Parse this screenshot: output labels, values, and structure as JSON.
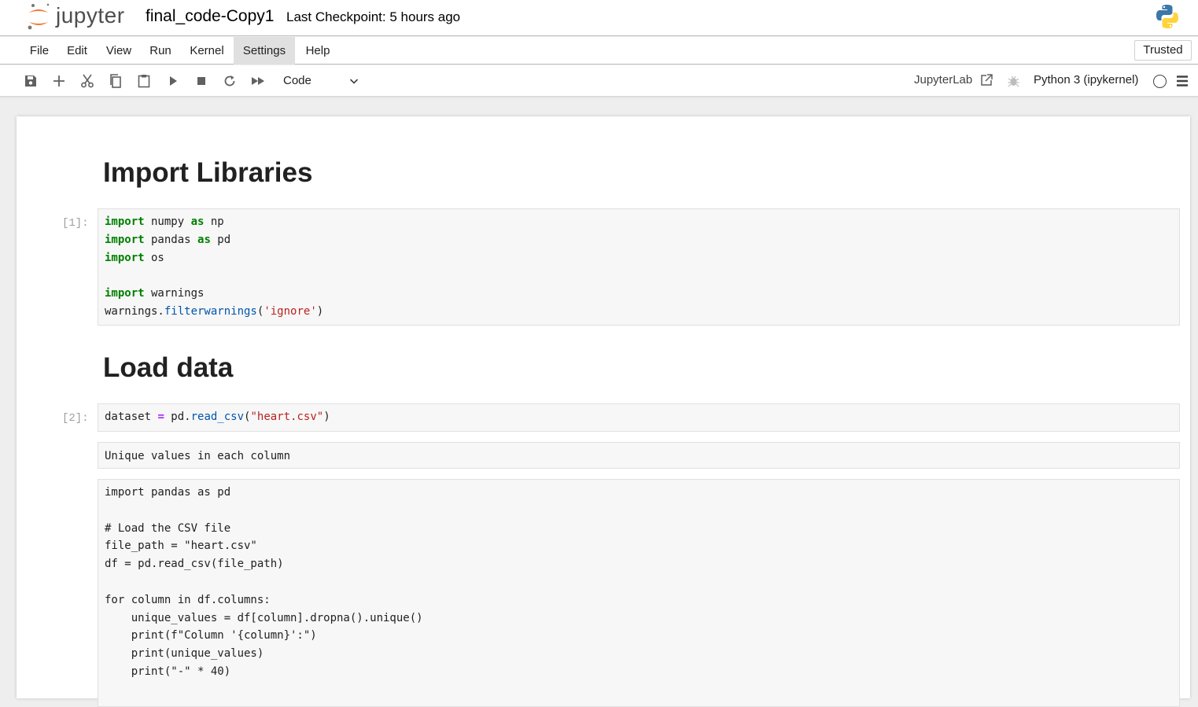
{
  "header": {
    "logo_text": "jupyter",
    "notebook_title": "final_code-Copy1",
    "checkpoint": "Last Checkpoint: 5 hours ago"
  },
  "menu": {
    "items": [
      "File",
      "Edit",
      "View",
      "Run",
      "Kernel",
      "Settings",
      "Help"
    ],
    "active": "Settings",
    "trusted": "Trusted"
  },
  "toolbar": {
    "buttons": [
      "save-icon",
      "add-cell-icon",
      "cut-icon",
      "copy-icon",
      "paste-icon",
      "run-icon",
      "stop-icon",
      "restart-icon",
      "fast-forward-icon"
    ],
    "cell_type": "Code",
    "jupyterlab_label": "JupyterLab",
    "kernel_name": "Python 3 (ipykernel)"
  },
  "cells": {
    "heading1": "Import Libraries",
    "prompt1": "[1]:",
    "heading2": "Load data",
    "prompt2": "[2]:",
    "code1_lines": [
      "import numpy as np",
      "import pandas as pd",
      "import os",
      "",
      "import warnings",
      "warnings.filterwarnings('ignore')"
    ],
    "code2_line": "dataset = pd.read_csv(\"heart.csv\")",
    "raw1": "Unique values in each column",
    "raw2_lines": [
      "import pandas as pd",
      "",
      "# Load the CSV file",
      "file_path = \"heart.csv\"",
      "df = pd.read_csv(file_path)",
      "",
      "for column in df.columns:",
      "    unique_values = df[column].dropna().unique()",
      "    print(f\"Column '{column}':\")",
      "    print(unique_values)",
      "    print(\"-\" * 40)"
    ]
  },
  "colors": {
    "keyword": "#008000",
    "operator": "#aa22ff",
    "function": "#0055aa",
    "string": "#ba2121",
    "prompt": "#9e9e9e"
  }
}
